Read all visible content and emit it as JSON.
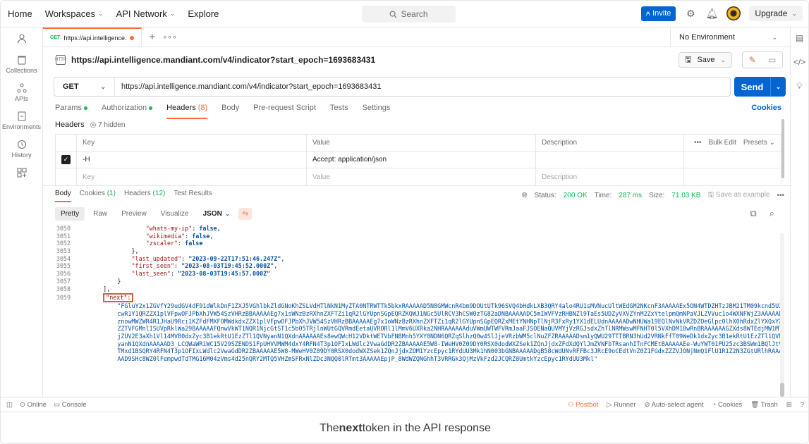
{
  "top_nav": {
    "home": "Home",
    "workspaces": "Workspaces",
    "api_network": "API Network",
    "explore": "Explore",
    "search_placeholder": "Search",
    "invite": "Invite",
    "upgrade": "Upgrade"
  },
  "sidebar": {
    "items": [
      {
        "label": "",
        "icon": "user-icon"
      },
      {
        "label": "Collections",
        "icon": "trash-can-icon"
      },
      {
        "label": "APIs",
        "icon": "apis-icon"
      },
      {
        "label": "Environments",
        "icon": "environment-icon"
      },
      {
        "label": "History",
        "icon": "history-icon"
      },
      {
        "label": "",
        "icon": "grid-add-icon"
      }
    ]
  },
  "tab": {
    "method": "GET",
    "label": "https://api.intelligence."
  },
  "environment": "No Environment",
  "request": {
    "title": "https://api.intelligence.mandiant.com/v4/indicator?start_epoch=1693683431",
    "save": "Save",
    "method": "GET",
    "url": "https://api.intelligence.mandiant.com/v4/indicator?start_epoch=1693683431",
    "send": "Send"
  },
  "request_tabs": {
    "params": "Params",
    "authorization": "Authorization",
    "headers": "Headers",
    "headers_count": "(8)",
    "body": "Body",
    "pre_request": "Pre-request Script",
    "tests": "Tests",
    "settings": "Settings",
    "cookies": "Cookies"
  },
  "headers_section": {
    "label": "Headers",
    "hidden": "7 hidden"
  },
  "headers_table": {
    "columns": [
      "Key",
      "Value",
      "Description"
    ],
    "bulk_edit": "Bulk Edit",
    "presets": "Presets",
    "rows": [
      {
        "key": "-H",
        "value": "Accept: application/json",
        "description": ""
      }
    ],
    "placeholder": {
      "key": "Key",
      "value": "Value",
      "description": "Description"
    }
  },
  "response_tabs": {
    "body": "Body",
    "cookies": "Cookies",
    "cookies_count": "(1)",
    "headers": "Headers",
    "headers_count": "(12)",
    "tests": "Test Results"
  },
  "response_status": {
    "status_label": "Status:",
    "status": "200 OK",
    "time_label": "Time:",
    "time": "287 ms",
    "size_label": "Size:",
    "size": "71.03 KB",
    "save_example": "Save as example"
  },
  "format_bar": {
    "pretty": "Pretty",
    "raw": "Raw",
    "preview": "Preview",
    "visualize": "Visualize",
    "format": "JSON"
  },
  "code_lines": [
    {
      "n": "3050",
      "indent": "                ",
      "key": "\"whats-my-ip\"",
      "value": "false",
      "trail": ","
    },
    {
      "n": "3051",
      "indent": "                ",
      "key": "\"wikimedia\"",
      "value": "false",
      "trail": ","
    },
    {
      "n": "3052",
      "indent": "                ",
      "key": "\"zscaler\"",
      "value": "false",
      "trail": ""
    },
    {
      "n": "3053",
      "indent": "            ",
      "plain": "},"
    },
    {
      "n": "3054",
      "indent": "            ",
      "key": "\"last_updated\"",
      "str": "\"2023-09-22T17:51:46.247Z\"",
      "trail": ","
    },
    {
      "n": "3055",
      "indent": "            ",
      "key": "\"first_seen\"",
      "str": "\"2023-08-03T19:45:52.000Z\"",
      "trail": ","
    },
    {
      "n": "3056",
      "indent": "            ",
      "key": "\"last_seen\"",
      "str": "\"2023-08-03T19:45:57.000Z\"",
      "trail": ""
    },
    {
      "n": "3057",
      "indent": "        ",
      "plain": "}"
    },
    {
      "n": "3058",
      "indent": "    ",
      "plain": "],"
    },
    {
      "n": "3059",
      "indent": "    ",
      "next_key": "\"next\":"
    }
  ],
  "next_token": "\"FGluY2x1ZGVfY29udGV4dF91dWlkDnF1ZXJ5VGhlbkZldGNoKhZSLVdHTlNkN1MyZTA0NTRWTTk5bkxRAAAAAD5N8GMWcnR4bm9DOUtUTk96SVQ4bHdkLXB3QRY4alo4RU1sMVNucUltWEdGM2NKcnF3AAAAAEx5ON4WTDZHTzJBM21TM09kcnd5U2cwR1Y1QRZZX1plVFpwOFJPbXhJVW54SzVHRzBBAAAAAEg7x1sWNzBzRXhnZXFTZi1qR2lGYUpnSGpEQRZKQWJ1NGc5UlRCV3hCSW0zTG82aDNBAAAAADC5mIWVFVzRHBNZl9TaEs5UDZyVXVZYnM2ZxYtelpmQmNPaVJLZVVuc1o4WXNFWjZ3AAAAADznowMWZWR4R1JHaU9Rci1KZFdFMXFOMWdkdxZZX1plVFpwOFJPbXhJVW54SzVHRzBBAAAAAEg7x1oWNzBzRXhnZXFTZi1qR2lGYUpnSGpEQRZxMEtYNHNpTlNjR3FxRy1YX1dELUdnAAAAADwNHUWa19EQlNvNkVRZDZOeGlpc0lhX0hRdxZlYXQxYXZZTVFGMnlISUVpRklWa29BAAAAAFQnwVkWT1NQR1NjcGtST1c5b05TRjlnWUtGQVRmdEetaUVRORl1lMmV6UXRka2NHRAAAAAAduVWmUWTWFVRmJaaFJSOENaQUVMYjVzRGJsdxZhTlNRMWswMFNHT0l5VXhDM18wRnBRAAAAAAGZXds8WTEdjMW1MTjZUV2E3aXh1Vl14MVB0dxZyc3B1ekRtU1EzZTl1QVNyanN1QXdnAAAAAAEs8ewQWcH12VDktWETVbFNBMnh5YXY0NDN6QRZqSlhzQ0w4SlJjeVRzbWM5clNuZFZRAAAAADsm1yQWU29TTTBRN3hUd2VRNkFfT09WeDk1dxZyc3B1ekRtU1EzZTl1QVNyanN1QXdnAAAAAD3_LCQWaWRiWC15V29SZENDS1FpUHVVMWM4dxY4RFN4T3p1OFIxLWdlc2VwaGdDR2ZBAAAAAE5W8-IWeHV0Z09DY0RSX0dodWXZSek1ZQnJjdxZFdXdQYlJmZVNFbTRsanhITnFCMEtBAAAAAEe-WuYWT01PU25zc3BSWm1BQlJtVTMxd1BSQRY4RFN4T3p1OFIxLWdlc2VwaGdDR2ZBAAAAAE5W8-MWeHV0Z09DY0RSX0dodWXZSek1ZQnJjdxZOM1YzcEpyc1RYdUU3Mk1hN003bGNBAAAAADgB58cWdUNvRFFBc3JRcE9oCEdtVnZ0Z1FGdxZZZVJONjNmQ1FlU1R1Z2N3ZGtURlhRAAAAAD9SHc8WZ0lFempwdTdTMG16M04zVms4d25nQRY2MTQ5VHZmSFRxNlZDc3NQQ0lRTmt3AAAAAEpjP_8WdWZQNGhhT3VRRGk3QjMzVkFzd2JCQRZ0UmtkYzcEpyc1RYdUU3Mkl\"",
  "footer": {
    "online": "Online",
    "console": "Console",
    "postbot": "Postbot",
    "runner": "Runner",
    "auto_select": "Auto-select agent",
    "cookies": "Cookies",
    "trash": "Trash"
  },
  "caption": {
    "prefix": "The ",
    "bold": "next",
    "suffix": " token in the API response"
  },
  "colors": {
    "accent": "#ff6c37",
    "primary": "#0265d2",
    "success": "#0cbb52",
    "highlight_box": "#e05a44"
  }
}
